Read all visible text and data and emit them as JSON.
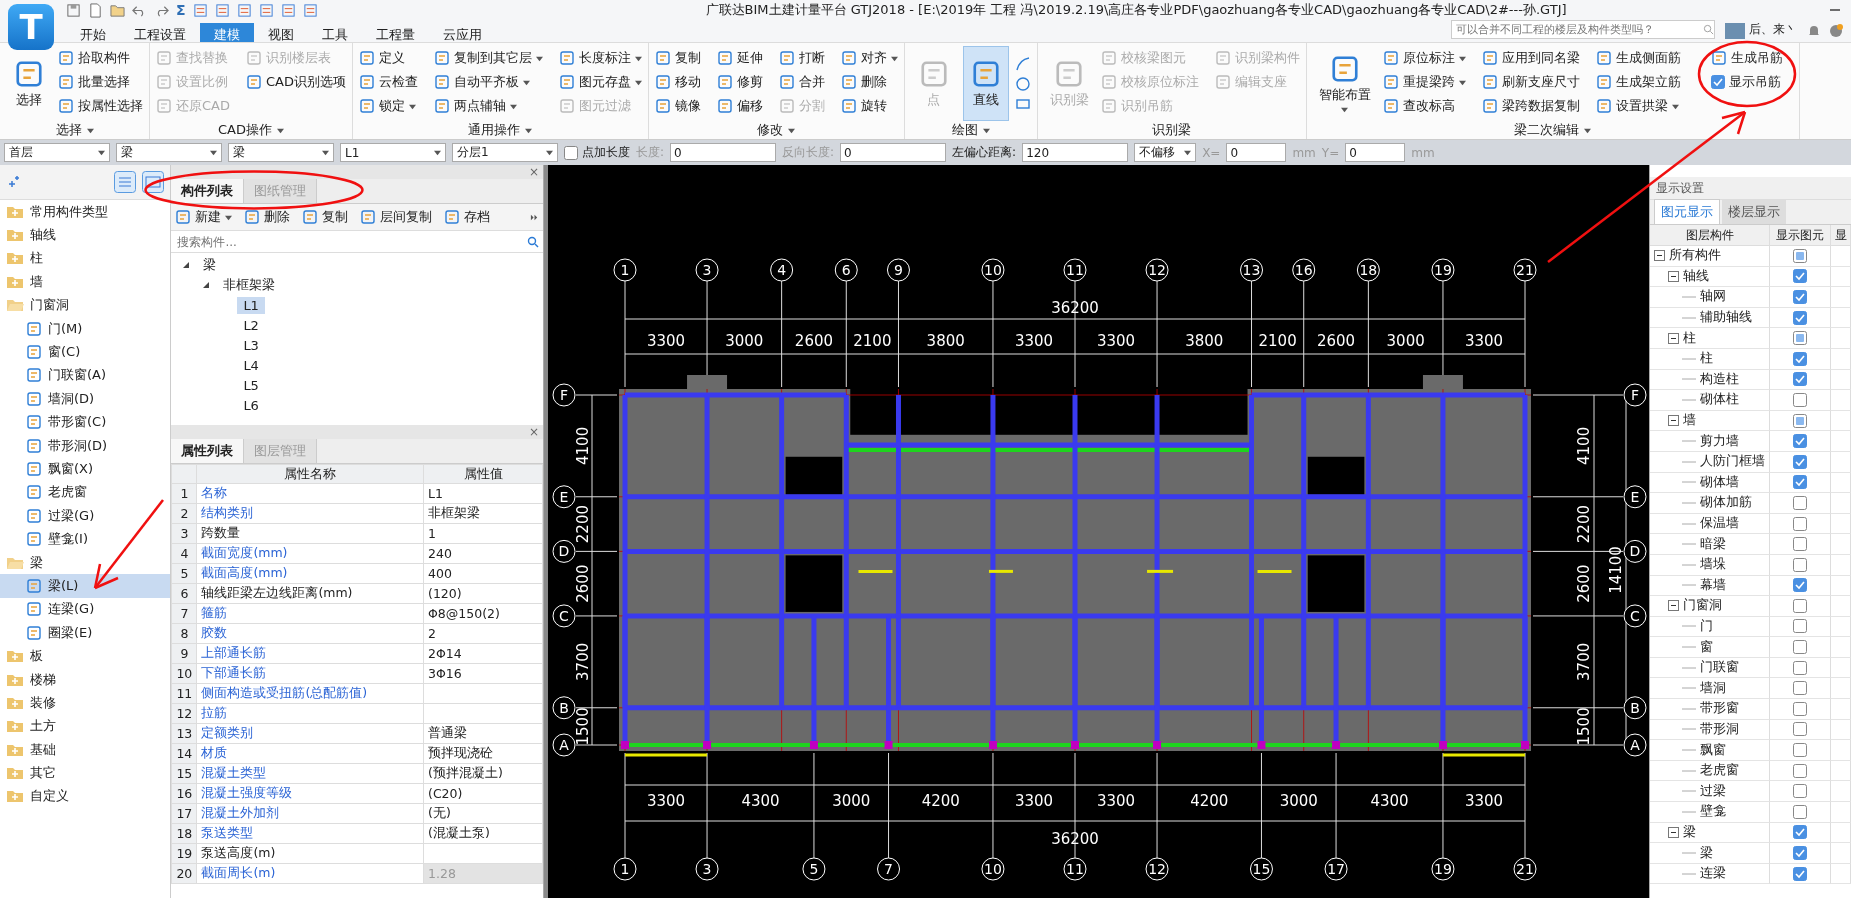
{
  "app": {
    "logo_letter": "T",
    "sigma_label": "Σ",
    "title": "广联达BIM土建计量平台 GTJ2018 - [E:\\2019年 工程  冯\\2019.2.19\\高庄各专业PDF\\gaozhuang各专业CAD\\gaozhuang各专业CAD\\2#---孙.GTJ]",
    "search_placeholder": "可以合并不同工程的楼层及构件类型吗？",
    "user_name": "后、来丶"
  },
  "menu_tabs": [
    {
      "label": "开始",
      "selected": false
    },
    {
      "label": "工程设置",
      "selected": false
    },
    {
      "label": "建模",
      "selected": true
    },
    {
      "label": "视图",
      "selected": false
    },
    {
      "label": "工具",
      "selected": false
    },
    {
      "label": "工程量",
      "selected": false
    },
    {
      "label": "云应用",
      "selected": false
    }
  ],
  "ribbon": [
    {
      "label": "选择",
      "kind": "standard",
      "dropdown": true,
      "big": [
        {
          "label": "选择",
          "selected": false,
          "disabled": false,
          "dropdown": false
        }
      ],
      "small": [
        {
          "label": "拾取构件",
          "kind": "button",
          "disabled": false,
          "dropdown": false
        },
        {
          "label": "批量选择",
          "kind": "button",
          "disabled": false,
          "dropdown": false
        },
        {
          "label": "按属性选择",
          "kind": "button",
          "disabled": false,
          "dropdown": false
        }
      ]
    },
    {
      "label": "CAD操作",
      "kind": "standard",
      "dropdown": true,
      "small": [
        {
          "label": "查找替换",
          "kind": "button",
          "disabled": true,
          "dropdown": false
        },
        {
          "label": "设置比例",
          "kind": "button",
          "disabled": true,
          "dropdown": false
        },
        {
          "label": "还原CAD",
          "kind": "button",
          "disabled": true,
          "dropdown": false
        },
        {
          "label": "识别楼层表",
          "kind": "button",
          "disabled": true,
          "dropdown": false
        },
        {
          "label": "CAD识别选项",
          "kind": "button",
          "disabled": false,
          "dropdown": false
        }
      ]
    },
    {
      "label": "通用操作",
      "kind": "standard",
      "dropdown": true,
      "small": [
        {
          "label": "定义",
          "kind": "button",
          "disabled": false,
          "dropdown": false
        },
        {
          "label": "云检查",
          "kind": "button",
          "disabled": false,
          "dropdown": false
        },
        {
          "label": "锁定",
          "kind": "button",
          "disabled": false,
          "dropdown": true
        },
        {
          "label": "复制到其它层",
          "kind": "button",
          "disabled": false,
          "dropdown": true
        },
        {
          "label": "自动平齐板",
          "kind": "button",
          "disabled": false,
          "dropdown": true
        },
        {
          "label": "两点辅轴",
          "kind": "button",
          "disabled": false,
          "dropdown": true
        },
        {
          "label": "长度标注",
          "kind": "button",
          "disabled": false,
          "dropdown": true
        },
        {
          "label": "图元存盘",
          "kind": "button",
          "disabled": false,
          "dropdown": true
        },
        {
          "label": "图元过滤",
          "kind": "button",
          "disabled": true,
          "dropdown": false
        }
      ]
    },
    {
      "label": "修改",
      "kind": "standard",
      "dropdown": true,
      "small": [
        {
          "label": "复制",
          "kind": "button",
          "disabled": false,
          "dropdown": false
        },
        {
          "label": "移动",
          "kind": "button",
          "disabled": false,
          "dropdown": false
        },
        {
          "label": "镜像",
          "kind": "button",
          "disabled": false,
          "dropdown": false
        },
        {
          "label": "延伸",
          "kind": "button",
          "disabled": false,
          "dropdown": false
        },
        {
          "label": "修剪",
          "kind": "button",
          "disabled": false,
          "dropdown": false
        },
        {
          "label": "偏移",
          "kind": "button",
          "disabled": false,
          "dropdown": false
        },
        {
          "label": "打断",
          "kind": "button",
          "disabled": false,
          "dropdown": false
        },
        {
          "label": "合并",
          "kind": "button",
          "disabled": false,
          "dropdown": false
        },
        {
          "label": "分割",
          "kind": "button",
          "disabled": true,
          "dropdown": false
        },
        {
          "label": "对齐",
          "kind": "button",
          "disabled": false,
          "dropdown": true
        },
        {
          "label": "删除",
          "kind": "button",
          "disabled": false,
          "dropdown": false
        },
        {
          "label": "旋转",
          "kind": "button",
          "disabled": false,
          "dropdown": false
        }
      ]
    },
    {
      "label": "绘图",
      "kind": "draw",
      "dropdown": true,
      "big": [
        {
          "label": "点",
          "selected": false,
          "disabled": true,
          "dropdown": false
        },
        {
          "label": "直线",
          "selected": true,
          "disabled": false,
          "dropdown": false
        }
      ]
    },
    {
      "label": "识别梁",
      "kind": "standard",
      "dropdown": false,
      "big": [
        {
          "label": "识别梁",
          "selected": false,
          "disabled": true,
          "dropdown": false
        }
      ],
      "small": [
        {
          "label": "校核梁图元",
          "kind": "button",
          "disabled": true,
          "dropdown": false
        },
        {
          "label": "校核原位标注",
          "kind": "button",
          "disabled": true,
          "dropdown": false
        },
        {
          "label": "识别吊筋",
          "kind": "button",
          "disabled": true,
          "dropdown": false
        },
        {
          "label": "识别梁构件",
          "kind": "button",
          "disabled": true,
          "dropdown": false
        },
        {
          "label": "编辑支座",
          "kind": "button",
          "disabled": true,
          "dropdown": false
        }
      ]
    },
    {
      "label": "梁二次编辑",
      "kind": "standard",
      "dropdown": true,
      "big": [
        {
          "label": "智能布置",
          "selected": false,
          "disabled": false,
          "dropdown": true
        }
      ],
      "small": [
        {
          "label": "原位标注",
          "kind": "button",
          "disabled": false,
          "dropdown": true
        },
        {
          "label": "重提梁跨",
          "kind": "button",
          "disabled": false,
          "dropdown": true
        },
        {
          "label": "查改标高",
          "kind": "button",
          "disabled": false,
          "dropdown": false
        },
        {
          "label": "应用到同名梁",
          "kind": "button",
          "disabled": false,
          "dropdown": false
        },
        {
          "label": "刷新支座尺寸",
          "kind": "button",
          "disabled": false,
          "dropdown": false
        },
        {
          "label": "梁跨数据复制",
          "kind": "button",
          "disabled": false,
          "dropdown": false
        },
        {
          "label": "生成侧面筋",
          "kind": "button",
          "disabled": false,
          "dropdown": false
        },
        {
          "label": "生成架立筋",
          "kind": "button",
          "disabled": false,
          "dropdown": false
        },
        {
          "label": "设置拱梁",
          "kind": "button",
          "disabled": false,
          "dropdown": true
        },
        {
          "label": "生成吊筋",
          "kind": "button",
          "disabled": false,
          "dropdown": false
        },
        {
          "label": "显示吊筋",
          "kind": "checkbox",
          "disabled": false,
          "checked": true
        }
      ]
    }
  ],
  "toolbar": {
    "selects": [
      {
        "value": "首层"
      },
      {
        "value": "梁"
      },
      {
        "value": "梁"
      },
      {
        "value": "L1"
      },
      {
        "value": "分层1"
      }
    ],
    "add_length": {
      "label": "点加长度",
      "checked": false
    },
    "fields": [
      {
        "label": "长度:",
        "value": "0",
        "disabled": true
      },
      {
        "label": "反向长度:",
        "value": "0",
        "disabled": true
      },
      {
        "label": "左偏心距离:",
        "value": "120",
        "disabled": false
      }
    ],
    "offset_mode": "不偏移",
    "coords": [
      {
        "label": "X=",
        "value": "0",
        "disabled": true,
        "unit": "mm"
      },
      {
        "label": "Y=",
        "value": "0",
        "disabled": true,
        "unit": "mm"
      }
    ]
  },
  "nav": [
    {
      "label": "常用构件类型",
      "expanded": false
    },
    {
      "label": "轴线",
      "expanded": false
    },
    {
      "label": "柱",
      "expanded": false
    },
    {
      "label": "墙",
      "expanded": false
    },
    {
      "label": "门窗洞",
      "expanded": true,
      "children": [
        {
          "label": "门(M)",
          "selected": false
        },
        {
          "label": "窗(C)",
          "selected": false
        },
        {
          "label": "门联窗(A)",
          "selected": false
        },
        {
          "label": "墙洞(D)",
          "selected": false
        },
        {
          "label": "带形窗(C)",
          "selected": false
        },
        {
          "label": "带形洞(D)",
          "selected": false
        },
        {
          "label": "飘窗(X)",
          "selected": false
        },
        {
          "label": "老虎窗",
          "selected": false
        },
        {
          "label": "过梁(G)",
          "selected": false
        },
        {
          "label": "壁龛(I)",
          "selected": false
        }
      ]
    },
    {
      "label": "梁",
      "expanded": true,
      "children": [
        {
          "label": "梁(L)",
          "selected": true
        },
        {
          "label": "连梁(G)",
          "selected": false
        },
        {
          "label": "圈梁(E)",
          "selected": false
        }
      ]
    },
    {
      "label": "板",
      "expanded": false
    },
    {
      "label": "楼梯",
      "expanded": false
    },
    {
      "label": "装修",
      "expanded": false
    },
    {
      "label": "土方",
      "expanded": false
    },
    {
      "label": "基础",
      "expanded": false
    },
    {
      "label": "其它",
      "expanded": false
    },
    {
      "label": "自定义",
      "expanded": false
    }
  ],
  "component_panel": {
    "close_label": "×",
    "tabs": [
      {
        "label": "构件列表",
        "selected": true
      },
      {
        "label": "图纸管理",
        "selected": false
      }
    ],
    "actions": [
      {
        "label": "新建",
        "dropdown": true
      },
      {
        "label": "删除",
        "dropdown": false
      },
      {
        "label": "复制",
        "dropdown": false
      },
      {
        "label": "层间复制",
        "dropdown": false
      },
      {
        "label": "存档",
        "dropdown": false
      }
    ],
    "search_placeholder": "搜索构件...",
    "tree": [
      {
        "label": "梁",
        "expanded": true,
        "children": [
          {
            "label": "非框架梁",
            "expanded": true,
            "children": [
              {
                "label": "L1",
                "selected": true
              },
              {
                "label": "L2",
                "selected": false
              },
              {
                "label": "L3",
                "selected": false
              },
              {
                "label": "L4",
                "selected": false
              },
              {
                "label": "L5",
                "selected": false
              },
              {
                "label": "L6",
                "selected": false
              }
            ]
          }
        ]
      }
    ]
  },
  "property_panel": {
    "close_label": "×",
    "tabs": [
      {
        "label": "属性列表",
        "selected": true
      },
      {
        "label": "图层管理",
        "selected": false
      }
    ],
    "columns": [
      "属性名称",
      "属性值"
    ],
    "rows": [
      {
        "no": "1",
        "name": "名称",
        "value": "L1",
        "public": true,
        "readonly": false
      },
      {
        "no": "2",
        "name": "结构类别",
        "value": "非框架梁",
        "public": true,
        "readonly": false
      },
      {
        "no": "3",
        "name": "跨数量",
        "value": "1",
        "public": false,
        "readonly": false
      },
      {
        "no": "4",
        "name": "截面宽度(mm)",
        "value": "240",
        "public": true,
        "readonly": false
      },
      {
        "no": "5",
        "name": "截面高度(mm)",
        "value": "400",
        "public": true,
        "readonly": false
      },
      {
        "no": "6",
        "name": "轴线距梁左边线距离(mm)",
        "value": "(120)",
        "public": false,
        "readonly": false
      },
      {
        "no": "7",
        "name": "箍筋",
        "value": "Φ8@150(2)",
        "public": true,
        "readonly": false
      },
      {
        "no": "8",
        "name": "胶数",
        "value": "2",
        "public": true,
        "readonly": false
      },
      {
        "no": "9",
        "name": "上部通长筋",
        "value": "2Φ14",
        "public": true,
        "readonly": false
      },
      {
        "no": "10",
        "name": "下部通长筋",
        "value": "3Φ16",
        "public": true,
        "readonly": false
      },
      {
        "no": "11",
        "name": "侧面构造或受扭筋(总配筋值)",
        "public": true,
        "readonly": false
      },
      {
        "no": "12",
        "name": "拉筋",
        "public": true,
        "readonly": false
      },
      {
        "no": "13",
        "name": "定额类别",
        "value": "普通梁",
        "public": true,
        "readonly": false
      },
      {
        "no": "14",
        "name": "材质",
        "value": "预拌现浇砼",
        "public": true,
        "readonly": false
      },
      {
        "no": "15",
        "name": "混凝土类型",
        "value": "(预拌混凝土)",
        "public": true,
        "readonly": false
      },
      {
        "no": "16",
        "name": "混凝土强度等级",
        "value": "(C20)",
        "public": true,
        "readonly": false
      },
      {
        "no": "17",
        "name": "混凝土外加剂",
        "value": "(无)",
        "public": true,
        "readonly": false
      },
      {
        "no": "18",
        "name": "泵送类型",
        "value": "(混凝土泵)",
        "public": true,
        "readonly": false
      },
      {
        "no": "19",
        "name": "泵送高度(m)",
        "public": false,
        "readonly": false
      },
      {
        "no": "20",
        "name": "截面周长(m)",
        "value": "1.28",
        "public": true,
        "readonly": true
      }
    ]
  },
  "canvas": {
    "top_axes": [
      "1",
      "3",
      "4",
      "6",
      "9",
      "10",
      "11",
      "12",
      "13",
      "16",
      "18",
      "19",
      "21"
    ],
    "top_total": "36200",
    "top_dims": [
      "3300",
      "3000",
      "2600",
      "2100",
      "3800",
      "3300",
      "3300",
      "3800",
      "2100",
      "2600",
      "3000",
      "3300"
    ],
    "bottom_axes": [
      "1",
      "3",
      "5",
      "7",
      "10",
      "11",
      "12",
      "15",
      "17",
      "19",
      "21"
    ],
    "bottom_total": "36200",
    "bottom_dims": [
      "3300",
      "4300",
      "3000",
      "4200",
      "3300",
      "3300",
      "4200",
      "3000",
      "4300",
      "3300"
    ],
    "left_axes": [
      "F",
      "E",
      "D",
      "C",
      "B",
      "A"
    ],
    "right_axes": [
      "F",
      "E",
      "D",
      "C",
      "B",
      "A"
    ],
    "left_dims": [
      "4100",
      "2200",
      "2600",
      "3700",
      "1500"
    ],
    "right_dims": [
      "4100",
      "2200",
      "2600",
      "3700",
      "1500"
    ],
    "right_total": "14100"
  },
  "display_panel": {
    "title": "显示设置",
    "tabs": [
      {
        "label": "图元显示",
        "selected": true
      },
      {
        "label": "楼层显示",
        "selected": false
      }
    ],
    "columns": [
      "图层构件",
      "显示图元",
      "显"
    ],
    "tree": [
      {
        "label": "所有构件",
        "checked": false,
        "partial": true,
        "expanded": true,
        "children": [
          {
            "label": "轴线",
            "checked": true,
            "expanded": true,
            "children": [
              {
                "label": "轴网",
                "checked": true
              },
              {
                "label": "辅助轴线",
                "checked": true
              }
            ]
          },
          {
            "label": "柱",
            "checked": false,
            "partial": true,
            "expanded": true,
            "children": [
              {
                "label": "柱",
                "checked": true
              },
              {
                "label": "构造柱",
                "checked": true
              },
              {
                "label": "砌体柱",
                "checked": false,
                "partial": false
              }
            ]
          },
          {
            "label": "墙",
            "checked": false,
            "partial": true,
            "expanded": true,
            "children": [
              {
                "label": "剪力墙",
                "checked": true
              },
              {
                "label": "人防门框墙",
                "checked": true
              },
              {
                "label": "砌体墙",
                "checked": true
              },
              {
                "label": "砌体加筋",
                "checked": false,
                "partial": false
              },
              {
                "label": "保温墙",
                "checked": false,
                "partial": false
              },
              {
                "label": "暗梁",
                "checked": false,
                "partial": false
              },
              {
                "label": "墙垛",
                "checked": false,
                "partial": false
              },
              {
                "label": "幕墙",
                "checked": true
              }
            ]
          },
          {
            "label": "门窗洞",
            "checked": false,
            "partial": false,
            "expanded": true,
            "children": [
              {
                "label": "门",
                "checked": false,
                "partial": false
              },
              {
                "label": "窗",
                "checked": false,
                "partial": false
              },
              {
                "label": "门联窗",
                "checked": false,
                "partial": false
              },
              {
                "label": "墙洞",
                "checked": false,
                "partial": false
              },
              {
                "label": "带形窗",
                "checked": false,
                "partial": false
              },
              {
                "label": "带形洞",
                "checked": false,
                "partial": false
              },
              {
                "label": "飘窗",
                "checked": false,
                "partial": false
              },
              {
                "label": "老虎窗",
                "checked": false,
                "partial": false
              },
              {
                "label": "过梁",
                "checked": false,
                "partial": false
              },
              {
                "label": "壁龛",
                "checked": false,
                "partial": false
              }
            ]
          },
          {
            "label": "梁",
            "checked": true,
            "expanded": true,
            "children": [
              {
                "label": "梁",
                "checked": true
              },
              {
                "label": "连梁",
                "checked": true
              }
            ]
          }
        ]
      }
    ]
  }
}
